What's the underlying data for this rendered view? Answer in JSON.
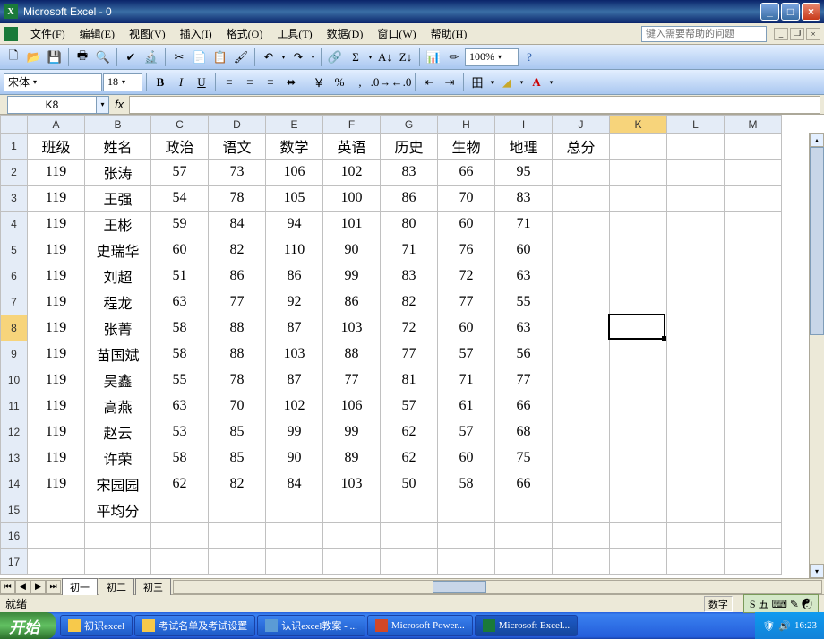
{
  "titlebar": {
    "title": "Microsoft Excel - 0"
  },
  "menu": {
    "items": [
      "文件(F)",
      "编辑(E)",
      "视图(V)",
      "插入(I)",
      "格式(O)",
      "工具(T)",
      "数据(D)",
      "窗口(W)",
      "帮助(H)"
    ],
    "help_placeholder": "键入需要帮助的问题"
  },
  "format_toolbar": {
    "font": "宋体",
    "size": "18",
    "zoom": "100%"
  },
  "namebox": "K8",
  "columns": [
    "A",
    "B",
    "C",
    "D",
    "E",
    "F",
    "G",
    "H",
    "I",
    "J",
    "K",
    "L",
    "M"
  ],
  "active": {
    "col": "K",
    "row": 8
  },
  "headers": [
    "班级",
    "姓名",
    "政治",
    "语文",
    "数学",
    "英语",
    "历史",
    "生物",
    "地理",
    "总分"
  ],
  "rows": [
    {
      "r": 2,
      "cells": [
        "119",
        "张涛",
        "57",
        "73",
        "106",
        "102",
        "83",
        "66",
        "95",
        "",
        "",
        "",
        ""
      ]
    },
    {
      "r": 3,
      "cells": [
        "119",
        "王强",
        "54",
        "78",
        "105",
        "100",
        "86",
        "70",
        "83",
        "",
        "",
        "",
        ""
      ]
    },
    {
      "r": 4,
      "cells": [
        "119",
        "王彬",
        "59",
        "84",
        "94",
        "101",
        "80",
        "60",
        "71",
        "",
        "",
        "",
        ""
      ]
    },
    {
      "r": 5,
      "cells": [
        "119",
        "史瑞华",
        "60",
        "82",
        "110",
        "90",
        "71",
        "76",
        "60",
        "",
        "",
        "",
        ""
      ]
    },
    {
      "r": 6,
      "cells": [
        "119",
        "刘超",
        "51",
        "86",
        "86",
        "99",
        "83",
        "72",
        "63",
        "",
        "",
        "",
        ""
      ]
    },
    {
      "r": 7,
      "cells": [
        "119",
        "程龙",
        "63",
        "77",
        "92",
        "86",
        "82",
        "77",
        "55",
        "",
        "",
        "",
        ""
      ]
    },
    {
      "r": 8,
      "cells": [
        "119",
        "张菁",
        "58",
        "88",
        "87",
        "103",
        "72",
        "60",
        "63",
        "",
        "",
        "",
        ""
      ]
    },
    {
      "r": 9,
      "cells": [
        "119",
        "苗国斌",
        "58",
        "88",
        "103",
        "88",
        "77",
        "57",
        "56",
        "",
        "",
        "",
        ""
      ]
    },
    {
      "r": 10,
      "cells": [
        "119",
        "吴鑫",
        "55",
        "78",
        "87",
        "77",
        "81",
        "71",
        "77",
        "",
        "",
        "",
        ""
      ]
    },
    {
      "r": 11,
      "cells": [
        "119",
        "高燕",
        "63",
        "70",
        "102",
        "106",
        "57",
        "61",
        "66",
        "",
        "",
        "",
        ""
      ]
    },
    {
      "r": 12,
      "cells": [
        "119",
        "赵云",
        "53",
        "85",
        "99",
        "99",
        "62",
        "57",
        "68",
        "",
        "",
        "",
        ""
      ]
    },
    {
      "r": 13,
      "cells": [
        "119",
        "许荣",
        "58",
        "85",
        "90",
        "89",
        "62",
        "60",
        "75",
        "",
        "",
        "",
        ""
      ]
    },
    {
      "r": 14,
      "cells": [
        "119",
        "宋园园",
        "62",
        "82",
        "84",
        "103",
        "50",
        "58",
        "66",
        "",
        "",
        "",
        ""
      ]
    },
    {
      "r": 15,
      "cells": [
        "",
        "平均分",
        "",
        "",
        "",
        "",
        "",
        "",
        "",
        "",
        "",
        "",
        ""
      ]
    },
    {
      "r": 16,
      "cells": [
        "",
        "",
        "",
        "",
        "",
        "",
        "",
        "",
        "",
        "",
        "",
        "",
        ""
      ]
    },
    {
      "r": 17,
      "cells": [
        "",
        "",
        "",
        "",
        "",
        "",
        "",
        "",
        "",
        "",
        "",
        "",
        ""
      ]
    }
  ],
  "sheets": [
    "初一",
    "初二",
    "初三"
  ],
  "status": {
    "ready": "就绪",
    "indicators": [
      "数字"
    ]
  },
  "ime": {
    "label": "S 五",
    "extra": "🌐"
  },
  "taskbar": {
    "start": "开始",
    "buttons": [
      {
        "label": "初识excel",
        "icon": "#f7c94b"
      },
      {
        "label": "考试名单及考试设置",
        "icon": "#f7c94b"
      },
      {
        "label": "认识excel教案 - ...",
        "icon": "#5b9bd5"
      },
      {
        "label": "Microsoft Power...",
        "icon": "#d24726"
      },
      {
        "label": "Microsoft Excel...",
        "icon": "#1a7a3a",
        "active": true
      }
    ],
    "clock": "16:23"
  }
}
